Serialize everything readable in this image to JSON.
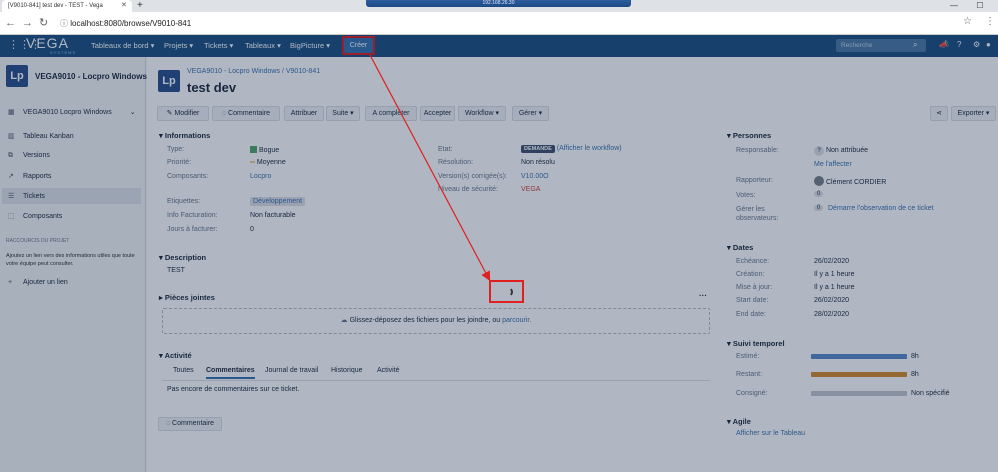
{
  "browser": {
    "tab_title": "[V9010-841] test dev - TEST - Vega",
    "tab_close": "✕",
    "new_tab": "+",
    "rdp_host": "192.168.26.30",
    "url": "localhost:8080/browse/V9010-841",
    "window_controls": "—  ☐  ✕"
  },
  "header": {
    "logo": "VEGA",
    "logo_sub": "SYSTEMS",
    "nav": [
      "Tableaux de bord ▾",
      "Projets ▾",
      "Tickets ▾",
      "Tableaux ▾",
      "BigPicture ▾"
    ],
    "create": "Créer",
    "search_placeholder": "Recherche"
  },
  "sidebar": {
    "project_avatar": "Lp",
    "project_name": "VEGA9010 - Locpro Windows",
    "board_selector": "VEGA9010 Locpro Windows",
    "items": [
      {
        "icon": "kanban-icon",
        "label": "Tableau Kanban"
      },
      {
        "icon": "versions-icon",
        "label": "Versions"
      },
      {
        "icon": "reports-icon",
        "label": "Rapports"
      },
      {
        "icon": "tickets-icon",
        "label": "Tickets"
      },
      {
        "icon": "components-icon",
        "label": "Composants"
      }
    ],
    "shortcuts_title": "RACCOURCIS DU PROJET",
    "shortcuts_desc": "Ajoutez un lien vers des informations utiles que toute votre équipe peut consulter.",
    "add_link": "Ajouter un lien"
  },
  "issue": {
    "breadcrumb_project": "VEGA9010 - Locpro Windows",
    "breadcrumb_sep": "/",
    "breadcrumb_key": "V9010-841",
    "title": "test dev",
    "toolbar": [
      "Modifier",
      "Commentaire",
      "Attribuer",
      "Suite ▾",
      "A compléter",
      "Accepter",
      "Workflow ▾",
      "Gérer ▾"
    ],
    "share": "",
    "export": "Exporter ▾"
  },
  "details": {
    "section": "Informations",
    "type_label": "Type:",
    "type_value": "Bogue",
    "priority_label": "Priorité:",
    "priority_value": "Moyenne",
    "components_label": "Composants:",
    "components_value": "Locpro",
    "tags_label": "Etiquettes:",
    "tags_value": "Développement",
    "billing_label": "Info Facturation:",
    "billing_value": "Non facturable",
    "days_label": "Jours à facturer:",
    "days_value": "0",
    "status_label": "Etat:",
    "status_value": "DEMANDE",
    "status_link": "(Afficher le workflow)",
    "resolution_label": "Résolution:",
    "resolution_value": "Non résolu",
    "fixversion_label": "Version(s) corrigée(s):",
    "fixversion_value": "V10.00O",
    "security_label": "Niveau de sécurité:",
    "security_value": "VEGA"
  },
  "description": {
    "section": "Description",
    "text": "TEST"
  },
  "attachments": {
    "section": "Pièces jointes",
    "drop_text": "Glissez-déposez des fichiers pour les joindre, ou ",
    "browse": "parcourir.",
    "more": "···"
  },
  "activity": {
    "section": "Activité",
    "tabs": [
      "Toutes",
      "Commentaires",
      "Journal de travail",
      "Historique",
      "Activité"
    ],
    "empty": "Pas encore de commentaires sur ce ticket.",
    "comment_button": "Commentaire"
  },
  "people": {
    "section": "Personnes",
    "assignee_label": "Responsable:",
    "assignee_value": "Non attribuée",
    "assign_me": "Me l'affecter",
    "reporter_label": "Rapporteur:",
    "reporter_value": "Clément CORDIER",
    "votes_label": "Votes:",
    "votes_value": "0",
    "watchers_label": "Gérer les observateurs:",
    "watchers_value": "0",
    "watch_link": "Démarre l'observation de ce ticket"
  },
  "dates": {
    "section": "Dates",
    "rows": [
      {
        "label": "Echéance:",
        "value": "26/02/2020"
      },
      {
        "label": "Création:",
        "value": "Il y a 1 heure"
      },
      {
        "label": "Mise à jour:",
        "value": "Il y a 1 heure"
      },
      {
        "label": "Start date:",
        "value": "26/02/2020"
      },
      {
        "label": "End date:",
        "value": "28/02/2020"
      }
    ]
  },
  "time_tracking": {
    "section": "Suivi temporel",
    "rows": [
      {
        "label": "Estimé:",
        "value": "8h",
        "fill": 1.0,
        "color": "#5a8bc7"
      },
      {
        "label": "Restant:",
        "value": "8h",
        "fill": 1.0,
        "color": "#d58b2b"
      },
      {
        "label": "Consigné:",
        "value": "Non spécifié",
        "fill": 0.0,
        "color": "#c3c8cf"
      }
    ]
  },
  "agile": {
    "section": "Agile",
    "link": "Afficher sur le Tableau"
  }
}
